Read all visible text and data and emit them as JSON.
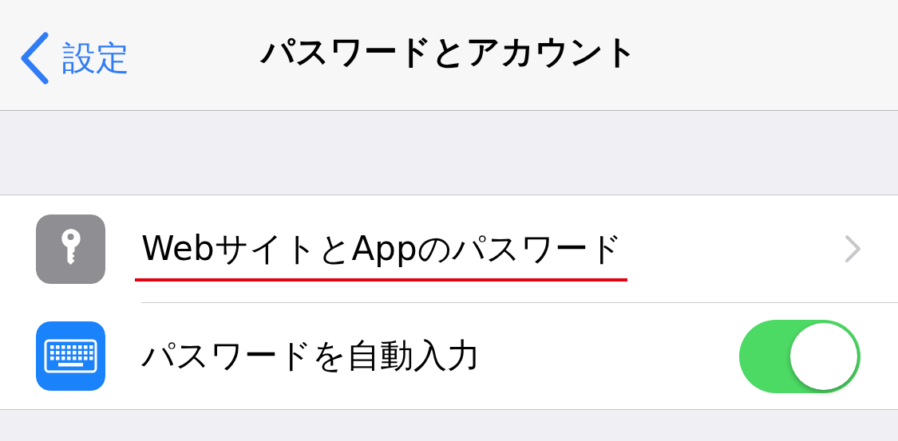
{
  "nav": {
    "back_label": "設定",
    "title": "パスワードとアカウント"
  },
  "rows": [
    {
      "kind": "link",
      "label": "WebサイトとAppのパスワード",
      "underlined": true
    },
    {
      "kind": "toggle",
      "label": "パスワードを自動入力",
      "on": true,
      "underlined": false
    }
  ]
}
